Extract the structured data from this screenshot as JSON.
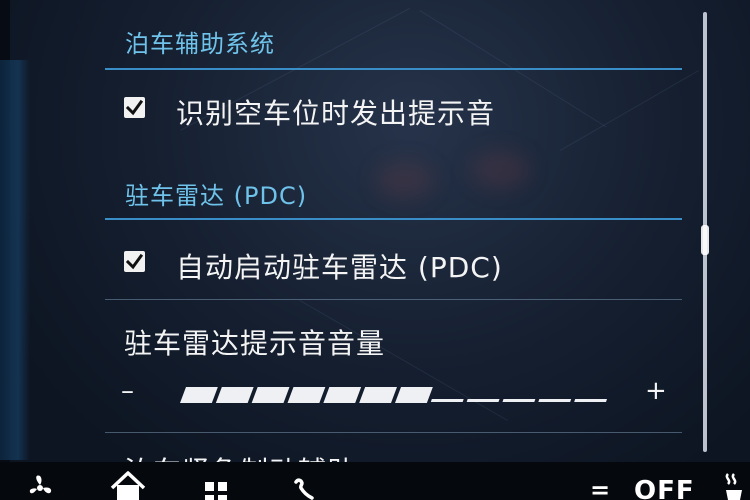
{
  "sections": {
    "parking_assist_header": "泊车辅助系统",
    "pdc_header": "驻车雷达 (PDC)"
  },
  "items": {
    "empty_spot_sound": {
      "label": "识别空车位时发出提示音",
      "checked": true
    },
    "auto_pdc": {
      "label": "自动启动驻车雷达 (PDC)",
      "checked": true
    }
  },
  "volume": {
    "label": "驻车雷达提示音音量",
    "minus": "–",
    "plus": "+",
    "level": 7,
    "max": 12
  },
  "next_item": {
    "label": "泊车紧急制动辅助"
  },
  "bottom_bar": {
    "off_label": "OFF",
    "eq_label": "=",
    "icons": [
      "fan-icon",
      "home-icon",
      "grid-icon",
      "phone-icon",
      "seat-heat-icon"
    ]
  },
  "colors": {
    "header": "#6fc3ea",
    "rule": "#3a8ec8",
    "background": "#151f30"
  }
}
